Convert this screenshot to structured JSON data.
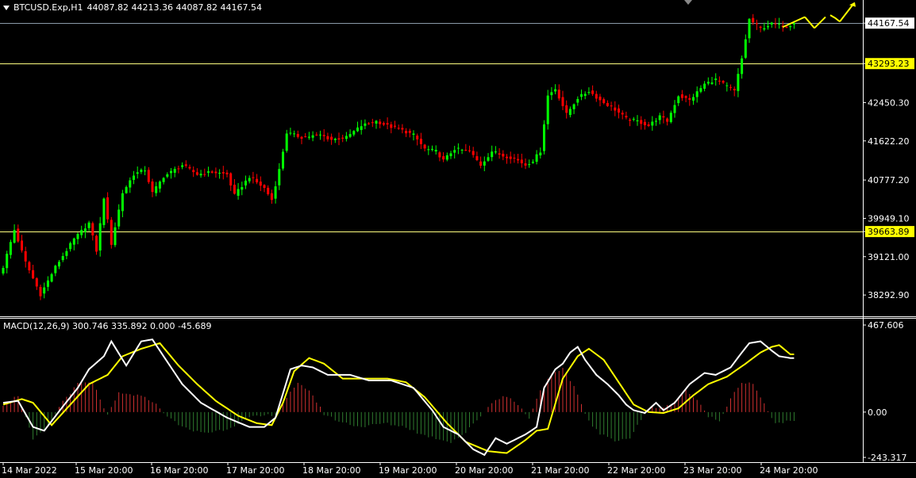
{
  "header": {
    "symbol": "BTCUSD.Exp,H1",
    "ohlc": "44087.82 44213.36 44087.82 44167.54"
  },
  "macd_header": "MACD(12,26,9) 300.746 335.892 0.000 -45.689",
  "colors": {
    "background": "#000000",
    "bull": "#00ff00",
    "bear": "#ff0000",
    "hline": "#ffff80",
    "bid_line": "#8a9aa8",
    "macd_main": "#ffffff",
    "macd_signal": "#ffff00",
    "hist_pos": "#d03030",
    "hist_neg": "#2f7d2f",
    "arrow": "#ffff00"
  },
  "chart_data": [
    {
      "type": "candlestick",
      "symbol": "BTCUSD.Exp",
      "timeframe": "H1",
      "ylim": [
        37850,
        44650
      ],
      "y_ticks": [
        "44167.54",
        "43293.23",
        "42450.30",
        "41622.20",
        "40777.20",
        "39949.10",
        "39663.89",
        "39121.00",
        "38292.90"
      ],
      "price_labels": [
        {
          "value": 44167.54,
          "label": "44167.54",
          "kind": "current"
        },
        {
          "value": 43293.23,
          "label": "43293.23",
          "kind": "level"
        },
        {
          "value": 39663.89,
          "label": "39663.89",
          "kind": "level"
        }
      ],
      "horizontal_levels": [
        43293.23,
        39663.89
      ],
      "x_ticks": [
        "14 Mar 2022",
        "15 Mar 20:00",
        "16 Mar 20:00",
        "17 Mar 20:00",
        "18 Mar 20:00",
        "19 Mar 20:00",
        "20 Mar 20:00",
        "21 Mar 20:00",
        "22 Mar 20:00",
        "23 Mar 20:00",
        "24 Mar 20:00"
      ],
      "close_anchors": [
        [
          0,
          38900
        ],
        [
          3,
          39700
        ],
        [
          6,
          39000
        ],
        [
          10,
          38300
        ],
        [
          14,
          38900
        ],
        [
          19,
          39500
        ],
        [
          23,
          39850
        ],
        [
          25,
          39250
        ],
        [
          27,
          40400
        ],
        [
          29,
          39400
        ],
        [
          32,
          40500
        ],
        [
          35,
          40900
        ],
        [
          38,
          41000
        ],
        [
          40,
          40500
        ],
        [
          43,
          40850
        ],
        [
          48,
          41100
        ],
        [
          52,
          40900
        ],
        [
          56,
          40950
        ],
        [
          60,
          40900
        ],
        [
          62,
          40450
        ],
        [
          66,
          40850
        ],
        [
          70,
          40600
        ],
        [
          72,
          40350
        ],
        [
          74,
          41000
        ],
        [
          76,
          41800
        ],
        [
          80,
          41700
        ],
        [
          85,
          41750
        ],
        [
          88,
          41650
        ],
        [
          92,
          41700
        ],
        [
          96,
          41950
        ],
        [
          100,
          42050
        ],
        [
          103,
          41950
        ],
        [
          107,
          41850
        ],
        [
          110,
          41750
        ],
        [
          113,
          41450
        ],
        [
          116,
          41400
        ],
        [
          118,
          41200
        ],
        [
          121,
          41450
        ],
        [
          125,
          41400
        ],
        [
          128,
          41100
        ],
        [
          131,
          41400
        ],
        [
          134,
          41300
        ],
        [
          137,
          41250
        ],
        [
          140,
          41100
        ],
        [
          142,
          41200
        ],
        [
          144,
          41400
        ],
        [
          146,
          42600
        ],
        [
          148,
          42750
        ],
        [
          151,
          42200
        ],
        [
          154,
          42550
        ],
        [
          157,
          42700
        ],
        [
          160,
          42500
        ],
        [
          164,
          42300
        ],
        [
          167,
          42100
        ],
        [
          170,
          42050
        ],
        [
          173,
          41950
        ],
        [
          176,
          42150
        ],
        [
          178,
          42050
        ],
        [
          181,
          42600
        ],
        [
          184,
          42500
        ],
        [
          188,
          42850
        ],
        [
          191,
          42950
        ],
        [
          194,
          42800
        ],
        [
          196,
          42700
        ],
        [
          198,
          43400
        ],
        [
          200,
          44250
        ],
        [
          203,
          44050
        ],
        [
          206,
          44150
        ],
        [
          210,
          44100
        ],
        [
          212,
          44167.54
        ]
      ],
      "macd": {
        "ylim": [
          -243.317,
          467.606
        ],
        "y_ticks": [
          "467.606",
          "0.00",
          "-243.317"
        ],
        "main_anchors": [
          [
            0,
            50
          ],
          [
            4,
            60
          ],
          [
            8,
            -80
          ],
          [
            11,
            -100
          ],
          [
            16,
            30
          ],
          [
            20,
            130
          ],
          [
            23,
            230
          ],
          [
            27,
            300
          ],
          [
            29,
            380
          ],
          [
            33,
            250
          ],
          [
            37,
            380
          ],
          [
            40,
            390
          ],
          [
            43,
            300
          ],
          [
            48,
            150
          ],
          [
            53,
            50
          ],
          [
            60,
            -30
          ],
          [
            66,
            -80
          ],
          [
            70,
            -80
          ],
          [
            73,
            -30
          ],
          [
            77,
            230
          ],
          [
            80,
            250
          ],
          [
            83,
            240
          ],
          [
            87,
            200
          ],
          [
            93,
            200
          ],
          [
            98,
            170
          ],
          [
            104,
            170
          ],
          [
            110,
            130
          ],
          [
            115,
            10
          ],
          [
            118,
            -80
          ],
          [
            122,
            -120
          ],
          [
            126,
            -200
          ],
          [
            129,
            -230
          ],
          [
            132,
            -140
          ],
          [
            135,
            -170
          ],
          [
            140,
            -120
          ],
          [
            143,
            -80
          ],
          [
            145,
            130
          ],
          [
            148,
            230
          ],
          [
            150,
            260
          ],
          [
            152,
            320
          ],
          [
            154,
            350
          ],
          [
            156,
            280
          ],
          [
            159,
            200
          ],
          [
            162,
            150
          ],
          [
            165,
            90
          ],
          [
            167,
            40
          ],
          [
            169,
            10
          ],
          [
            172,
            -5
          ],
          [
            175,
            50
          ],
          [
            177,
            10
          ],
          [
            180,
            50
          ],
          [
            184,
            150
          ],
          [
            188,
            210
          ],
          [
            191,
            200
          ],
          [
            195,
            240
          ],
          [
            198,
            320
          ],
          [
            200,
            370
          ],
          [
            203,
            380
          ],
          [
            206,
            330
          ],
          [
            208,
            300
          ],
          [
            211,
            290
          ]
        ],
        "signal_anchors": [
          [
            0,
            40
          ],
          [
            5,
            70
          ],
          [
            8,
            50
          ],
          [
            13,
            -70
          ],
          [
            18,
            40
          ],
          [
            23,
            150
          ],
          [
            28,
            200
          ],
          [
            32,
            300
          ],
          [
            37,
            340
          ],
          [
            42,
            370
          ],
          [
            47,
            250
          ],
          [
            52,
            150
          ],
          [
            57,
            60
          ],
          [
            63,
            -20
          ],
          [
            68,
            -60
          ],
          [
            72,
            -70
          ],
          [
            75,
            50
          ],
          [
            78,
            220
          ],
          [
            82,
            290
          ],
          [
            86,
            260
          ],
          [
            91,
            180
          ],
          [
            97,
            180
          ],
          [
            103,
            180
          ],
          [
            108,
            160
          ],
          [
            113,
            80
          ],
          [
            119,
            -60
          ],
          [
            124,
            -160
          ],
          [
            130,
            -210
          ],
          [
            135,
            -220
          ],
          [
            140,
            -150
          ],
          [
            143,
            -100
          ],
          [
            146,
            -90
          ],
          [
            150,
            180
          ],
          [
            154,
            300
          ],
          [
            157,
            340
          ],
          [
            161,
            280
          ],
          [
            165,
            160
          ],
          [
            169,
            40
          ],
          [
            173,
            0
          ],
          [
            177,
            -5
          ],
          [
            181,
            20
          ],
          [
            185,
            90
          ],
          [
            189,
            150
          ],
          [
            194,
            190
          ],
          [
            199,
            260
          ],
          [
            203,
            320
          ],
          [
            206,
            350
          ],
          [
            208,
            360
          ],
          [
            211,
            310
          ]
        ],
        "hist_anchors": [
          [
            0,
            40
          ],
          [
            4,
            90
          ],
          [
            8,
            -150
          ],
          [
            12,
            -80
          ],
          [
            16,
            60
          ],
          [
            20,
            150
          ],
          [
            24,
            160
          ],
          [
            28,
            -20
          ],
          [
            31,
            100
          ],
          [
            36,
            90
          ],
          [
            40,
            60
          ],
          [
            45,
            -40
          ],
          [
            50,
            -100
          ],
          [
            55,
            -110
          ],
          [
            60,
            -90
          ],
          [
            66,
            -30
          ],
          [
            70,
            -20
          ],
          [
            73,
            -10
          ],
          [
            76,
            80
          ],
          [
            79,
            150
          ],
          [
            82,
            120
          ],
          [
            86,
            -10
          ],
          [
            90,
            -50
          ],
          [
            96,
            -80
          ],
          [
            102,
            -60
          ],
          [
            108,
            -80
          ],
          [
            112,
            -120
          ],
          [
            116,
            -140
          ],
          [
            120,
            -160
          ],
          [
            124,
            -110
          ],
          [
            128,
            -20
          ],
          [
            131,
            50
          ],
          [
            134,
            90
          ],
          [
            137,
            60
          ],
          [
            141,
            -30
          ],
          [
            144,
            120
          ],
          [
            147,
            200
          ],
          [
            150,
            230
          ],
          [
            153,
            140
          ],
          [
            157,
            -50
          ],
          [
            160,
            -120
          ],
          [
            164,
            -150
          ],
          [
            168,
            -140
          ],
          [
            171,
            -40
          ],
          [
            174,
            30
          ],
          [
            177,
            20
          ],
          [
            180,
            60
          ],
          [
            183,
            120
          ],
          [
            186,
            60
          ],
          [
            189,
            -20
          ],
          [
            192,
            -50
          ],
          [
            195,
            80
          ],
          [
            198,
            160
          ],
          [
            201,
            150
          ],
          [
            204,
            40
          ],
          [
            207,
            -60
          ],
          [
            211,
            -50
          ]
        ]
      }
    }
  ]
}
